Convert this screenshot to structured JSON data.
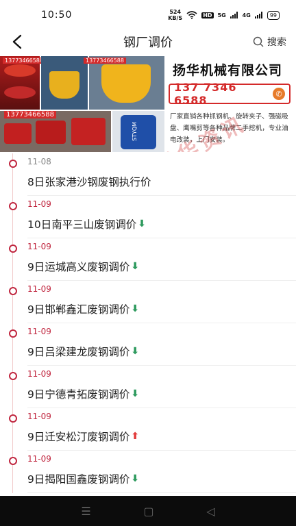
{
  "status": {
    "time": "10:50",
    "netspeed_value": "524",
    "netspeed_unit": "KB/S",
    "hd": "HD",
    "signal1": "5G",
    "signal2": "4G",
    "battery": "99"
  },
  "nav": {
    "title": "钢厂调价",
    "search_label": "搜索"
  },
  "banner": {
    "company": "扬华机械有限公司",
    "phone": "137 7346 6588",
    "phone_tag1": "13773466588",
    "phone_tag2": "13773466588",
    "phone_tag3": "13773466588",
    "product_label": "STYQM",
    "description": "厂家直销各种抓钢机、旋转夹子、强磁吸盘、鹰嘴剪等各种品牌二手挖机，专业油电改装，上门安装。",
    "watermark": "扬华资讯"
  },
  "items": [
    {
      "date": "11-08",
      "title": "8日张家港沙钢废钢执行价",
      "trend": ""
    },
    {
      "date": "11-09",
      "title": "10日南平三山废钢调价",
      "trend": "down"
    },
    {
      "date": "11-09",
      "title": "9日运城高义废钢调价",
      "trend": "down"
    },
    {
      "date": "11-09",
      "title": "9日邯郸鑫汇废钢调价",
      "trend": "down"
    },
    {
      "date": "11-09",
      "title": "9日吕梁建龙废钢调价",
      "trend": "down"
    },
    {
      "date": "11-09",
      "title": "9日宁德青拓废钢调价",
      "trend": "down"
    },
    {
      "date": "11-09",
      "title": "9日迁安松汀废钢调价",
      "trend": "up"
    },
    {
      "date": "11-09",
      "title": "9日揭阳国鑫废钢调价",
      "trend": "down"
    }
  ],
  "icons": {
    "down": "down-arrow-icon",
    "up": "up-arrow-icon"
  },
  "colors": {
    "accent": "#c0263f",
    "down": "#2e9a5e",
    "up": "#e23b3b"
  }
}
